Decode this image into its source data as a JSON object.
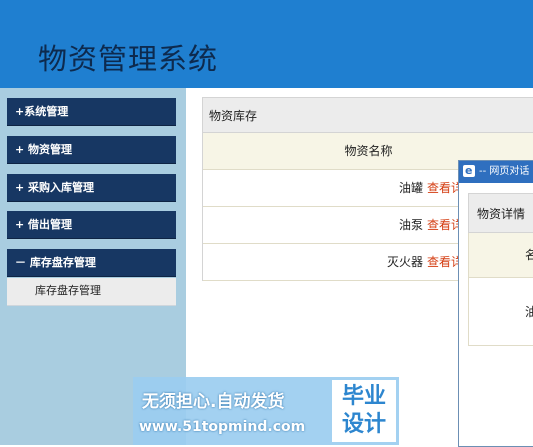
{
  "header": {
    "title": "物资管理系统"
  },
  "sidebar": {
    "items": [
      {
        "label": "+系统管理"
      },
      {
        "label": "+ 物资管理"
      },
      {
        "label": "+ 采购入库管理"
      },
      {
        "label": "+ 借出管理"
      },
      {
        "label": "－ 库存盘存管理"
      }
    ],
    "submenu": {
      "label": "库存盘存管理"
    }
  },
  "main": {
    "panel_title": "物资库存",
    "column_header": "物资名称",
    "rows": [
      {
        "name": "油罐",
        "link": "查看详"
      },
      {
        "name": "油泵",
        "link": "查看详"
      },
      {
        "name": "灭火器",
        "link": "查看详"
      }
    ]
  },
  "dialog": {
    "title": "-- 网页对话",
    "header": "物资详情",
    "col_label": "名",
    "value": "油"
  },
  "watermark": {
    "line1": "无须担心.自动发货",
    "line2": "www.51topmind.com",
    "badge_line1": "毕业",
    "badge_line2": "设计"
  }
}
